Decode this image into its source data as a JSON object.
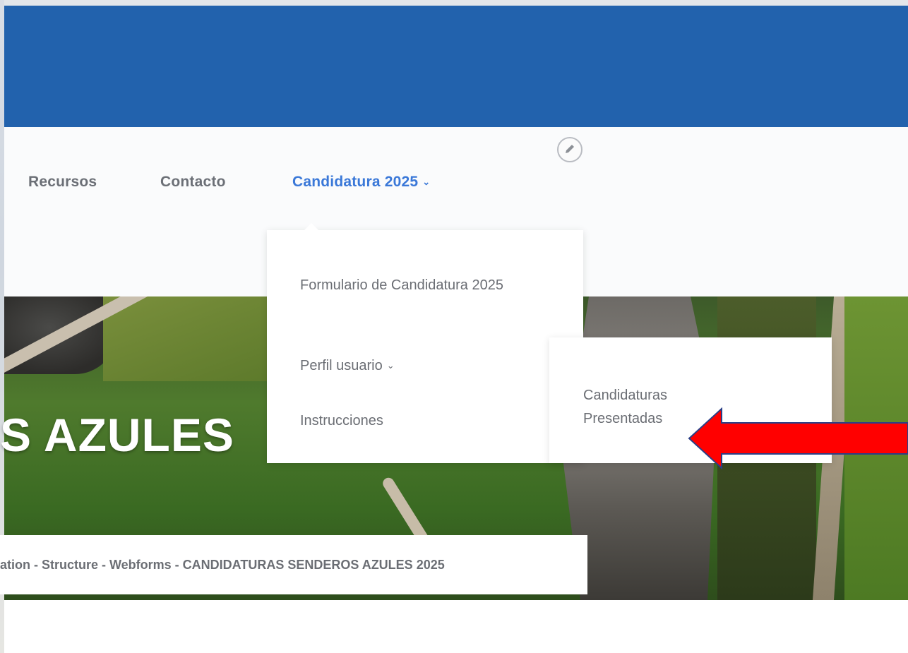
{
  "nav": {
    "items": [
      {
        "label": "Recursos"
      },
      {
        "label": "Contacto"
      },
      {
        "label": "Candidatura 2025",
        "chevron": "⌄"
      }
    ],
    "active_color": "#3a78d8",
    "text_color": "#6b6f76"
  },
  "header": {
    "color": "#2262ad"
  },
  "dropdown": {
    "items": [
      {
        "label": "Formulario de Candidatura 2025"
      },
      {
        "label": "Perfil usuario",
        "chevron": "⌄"
      },
      {
        "label": "Instrucciones"
      }
    ]
  },
  "submenu": {
    "items": [
      {
        "label": "Candidaturas Presentadas"
      }
    ]
  },
  "hero": {
    "title": "S AZULES"
  },
  "breadcrumb": {
    "text": "ation - Structure - Webforms - CANDIDATURAS SENDEROS AZULES 2025"
  },
  "icons": {
    "edit": "pencil-icon",
    "annotation": "red-arrow-icon"
  },
  "annotation_color": "#ff0000"
}
